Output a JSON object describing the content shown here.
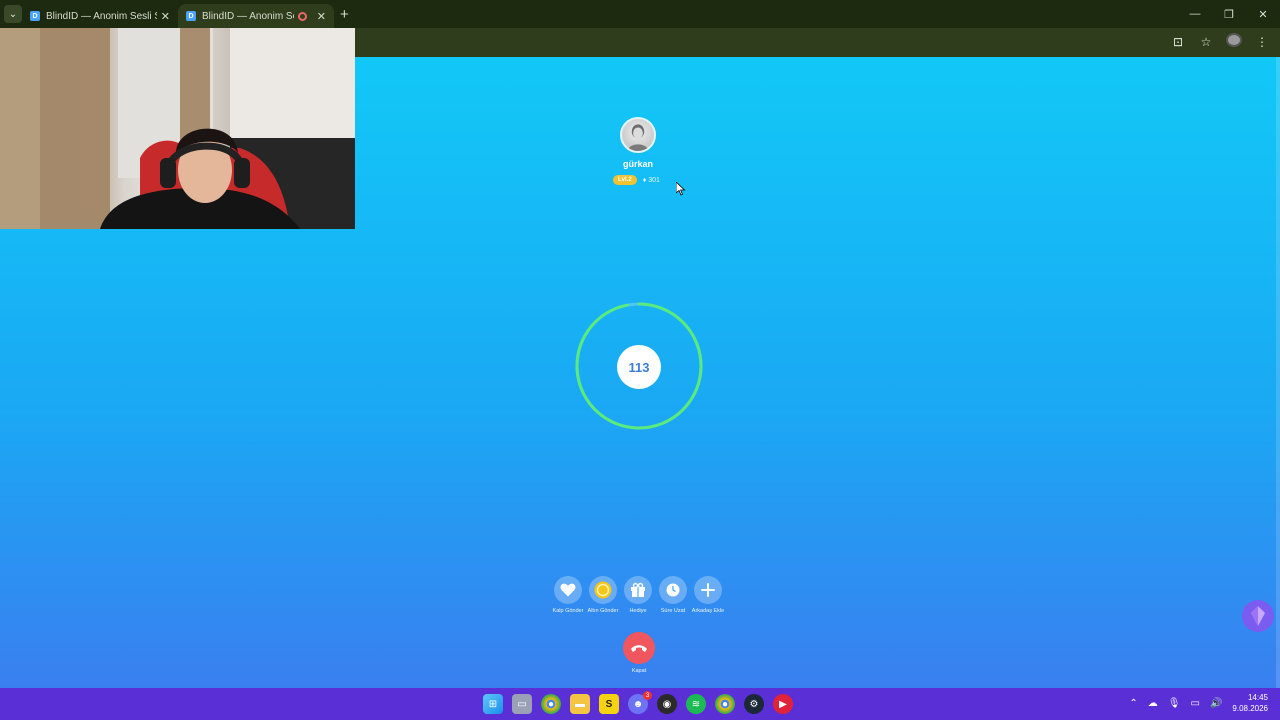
{
  "browser": {
    "tabs": [
      {
        "title": "BlindID — Anonim Sesli Sohbet",
        "favicon": "D",
        "active": false,
        "recording": false
      },
      {
        "title": "BlindID — Anonim Sesli Sohbet",
        "favicon": "D",
        "active": true,
        "recording": true
      }
    ],
    "new_tab_label": "+"
  },
  "call": {
    "user": {
      "name": "gürkan",
      "level": "Lvl.2",
      "gems": "301"
    },
    "timer": {
      "value": "113",
      "progress": 0.97,
      "ring_color": "#5bea7c"
    },
    "actions": [
      {
        "label": "Kalp Gönder",
        "icon": "heart-icon"
      },
      {
        "label": "Altın Gönder",
        "icon": "gold-coin-icon"
      },
      {
        "label": "Hediye",
        "icon": "gift-icon"
      },
      {
        "label": "Süre Uzat",
        "icon": "clock-icon"
      },
      {
        "label": "Arkadaş Ekle",
        "icon": "plus-icon"
      }
    ],
    "hangup_label": "Kapat"
  },
  "taskbar": {
    "time": "14:45",
    "date": "9.08.2026",
    "discord_badge": "3"
  },
  "colors": {
    "page_top": "#12c8f7",
    "page_bottom": "#3a7ff0",
    "hangup": "#f0565d",
    "level_badge": "#f2c230",
    "taskbar": "#5a2fd6"
  }
}
